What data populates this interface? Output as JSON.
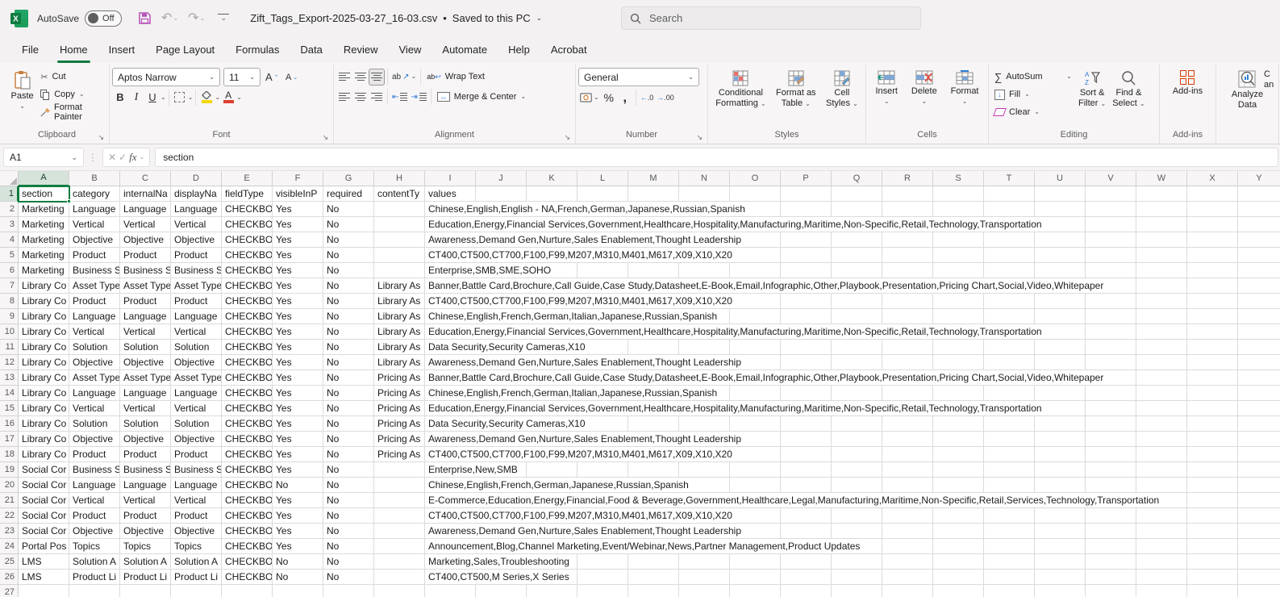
{
  "title_bar": {
    "autosave_label": "AutoSave",
    "autosave_state": "Off",
    "file_name": "Zift_Tags_Export-2025-03-27_16-03.csv",
    "separator": "•",
    "save_status": "Saved to this PC",
    "search_placeholder": "Search"
  },
  "tabs": [
    "File",
    "Home",
    "Insert",
    "Page Layout",
    "Formulas",
    "Data",
    "Review",
    "View",
    "Automate",
    "Help",
    "Acrobat"
  ],
  "active_tab_index": 1,
  "ribbon": {
    "clipboard": {
      "group_label": "Clipboard",
      "paste_label": "Paste",
      "cut_label": "Cut",
      "copy_label": "Copy",
      "format_painter_label": "Format Painter"
    },
    "font": {
      "group_label": "Font",
      "font_name": "Aptos Narrow",
      "font_size": "11",
      "bold": "B",
      "italic": "I",
      "underline": "U"
    },
    "alignment": {
      "group_label": "Alignment",
      "wrap_text_label": "Wrap Text",
      "merge_center_label": "Merge & Center",
      "orientation_label": "ab"
    },
    "number": {
      "group_label": "Number",
      "format_value": "General",
      "percent": "%",
      "comma": ",",
      "inc_decimal": "←.0",
      "dec_decimal": "→.00"
    },
    "styles": {
      "group_label": "Styles",
      "conditional_line1": "Conditional",
      "conditional_line2": "Formatting",
      "format_table_line1": "Format as",
      "format_table_line2": "Table",
      "cell_styles_line1": "Cell",
      "cell_styles_line2": "Styles"
    },
    "cells": {
      "group_label": "Cells",
      "insert_label": "Insert",
      "delete_label": "Delete",
      "format_label": "Format"
    },
    "editing": {
      "group_label": "Editing",
      "autosum_label": "AutoSum",
      "fill_label": "Fill",
      "clear_label": "Clear",
      "sort_filter_line1": "Sort &",
      "sort_filter_line2": "Filter",
      "find_select_line1": "Find &",
      "find_select_line2": "Select"
    },
    "addins": {
      "group_label": "Add-ins",
      "addins_label": "Add-ins"
    },
    "analyze": {
      "line1": "Analyze",
      "line2": "Data"
    },
    "clipped_group": {
      "line1": "C",
      "line2": "an"
    }
  },
  "formula_bar": {
    "name_box": "A1",
    "formula": "section",
    "fx": "fx"
  },
  "sheet": {
    "selected_cell": "A1",
    "columns": [
      "A",
      "B",
      "C",
      "D",
      "E",
      "F",
      "G",
      "H",
      "I",
      "J",
      "K",
      "L",
      "M",
      "N",
      "O",
      "P",
      "Q",
      "R",
      "S",
      "T",
      "U",
      "V",
      "W",
      "X",
      "Y"
    ],
    "rows": [
      {
        "n": "1",
        "cells": [
          "section",
          "category",
          "internalNa",
          "displayNa",
          "fieldType",
          "visibleInP",
          "required",
          "contentTy"
        ],
        "values": "values"
      },
      {
        "n": "2",
        "cells": [
          "Marketing",
          "Language",
          "Language",
          "Language",
          "CHECKBOX",
          "Yes",
          "No",
          ""
        ],
        "values": "Chinese,English,English - NA,French,German,Japanese,Russian,Spanish"
      },
      {
        "n": "3",
        "cells": [
          "Marketing",
          "Vertical",
          "Vertical",
          "Vertical",
          "CHECKBOX",
          "Yes",
          "No",
          ""
        ],
        "values": "Education,Energy,Financial Services,Government,Healthcare,Hospitality,Manufacturing,Maritime,Non-Specific,Retail,Technology,Transportation"
      },
      {
        "n": "4",
        "cells": [
          "Marketing",
          "Objective",
          "Objective",
          "Objective",
          "CHECKBOX",
          "Yes",
          "No",
          ""
        ],
        "values": "Awareness,Demand Gen,Nurture,Sales Enablement,Thought Leadership"
      },
      {
        "n": "5",
        "cells": [
          "Marketing",
          "Product",
          "Product",
          "Product",
          "CHECKBOX",
          "Yes",
          "No",
          ""
        ],
        "values": "CT400,CT500,CT700,F100,F99,M207,M310,M401,M617,X09,X10,X20"
      },
      {
        "n": "6",
        "cells": [
          "Marketing",
          "Business S",
          "Business S",
          "Business S",
          "CHECKBOX",
          "Yes",
          "No",
          ""
        ],
        "values": "Enterprise,SMB,SME,SOHO"
      },
      {
        "n": "7",
        "cells": [
          "Library Co",
          "Asset Type",
          "Asset Type",
          "Asset Type",
          "CHECKBOX",
          "Yes",
          "No",
          "Library As"
        ],
        "values": "Banner,Battle Card,Brochure,Call Guide,Case Study,Datasheet,E-Book,Email,Infographic,Other,Playbook,Presentation,Pricing Chart,Social,Video,Whitepaper"
      },
      {
        "n": "8",
        "cells": [
          "Library Co",
          "Product",
          "Product",
          "Product",
          "CHECKBOX",
          "Yes",
          "No",
          "Library As"
        ],
        "values": "CT400,CT500,CT700,F100,F99,M207,M310,M401,M617,X09,X10,X20"
      },
      {
        "n": "9",
        "cells": [
          "Library Co",
          "Language",
          "Language",
          "Language",
          "CHECKBOX",
          "Yes",
          "No",
          "Library As"
        ],
        "values": "Chinese,English,French,German,Italian,Japanese,Russian,Spanish"
      },
      {
        "n": "10",
        "cells": [
          "Library Co",
          "Vertical",
          "Vertical",
          "Vertical",
          "CHECKBOX",
          "Yes",
          "No",
          "Library As"
        ],
        "values": "Education,Energy,Financial Services,Government,Healthcare,Hospitality,Manufacturing,Maritime,Non-Specific,Retail,Technology,Transportation"
      },
      {
        "n": "11",
        "cells": [
          "Library Co",
          "Solution",
          "Solution",
          "Solution",
          "CHECKBOX",
          "Yes",
          "No",
          "Library As"
        ],
        "values": "Data Security,Security Cameras,X10"
      },
      {
        "n": "12",
        "cells": [
          "Library Co",
          "Objective",
          "Objective",
          "Objective",
          "CHECKBOX",
          "Yes",
          "No",
          "Library As"
        ],
        "values": "Awareness,Demand Gen,Nurture,Sales Enablement,Thought Leadership"
      },
      {
        "n": "13",
        "cells": [
          "Library Co",
          "Asset Type",
          "Asset Type",
          "Asset Type",
          "CHECKBOX",
          "Yes",
          "No",
          "Pricing As"
        ],
        "values": "Banner,Battle Card,Brochure,Call Guide,Case Study,Datasheet,E-Book,Email,Infographic,Other,Playbook,Presentation,Pricing Chart,Social,Video,Whitepaper"
      },
      {
        "n": "14",
        "cells": [
          "Library Co",
          "Language",
          "Language",
          "Language",
          "CHECKBOX",
          "Yes",
          "No",
          "Pricing As"
        ],
        "values": "Chinese,English,French,German,Italian,Japanese,Russian,Spanish"
      },
      {
        "n": "15",
        "cells": [
          "Library Co",
          "Vertical",
          "Vertical",
          "Vertical",
          "CHECKBOX",
          "Yes",
          "No",
          "Pricing As"
        ],
        "values": "Education,Energy,Financial Services,Government,Healthcare,Hospitality,Manufacturing,Maritime,Non-Specific,Retail,Technology,Transportation"
      },
      {
        "n": "16",
        "cells": [
          "Library Co",
          "Solution",
          "Solution",
          "Solution",
          "CHECKBOX",
          "Yes",
          "No",
          "Pricing As"
        ],
        "values": "Data Security,Security Cameras,X10"
      },
      {
        "n": "17",
        "cells": [
          "Library Co",
          "Objective",
          "Objective",
          "Objective",
          "CHECKBOX",
          "Yes",
          "No",
          "Pricing As"
        ],
        "values": "Awareness,Demand Gen,Nurture,Sales Enablement,Thought Leadership"
      },
      {
        "n": "18",
        "cells": [
          "Library Co",
          "Product",
          "Product",
          "Product",
          "CHECKBOX",
          "Yes",
          "No",
          "Pricing As"
        ],
        "values": "CT400,CT500,CT700,F100,F99,M207,M310,M401,M617,X09,X10,X20"
      },
      {
        "n": "19",
        "cells": [
          "Social Cor",
          "Business S",
          "Business S",
          "Business S",
          "CHECKBOX",
          "Yes",
          "No",
          ""
        ],
        "values": "Enterprise,New,SMB"
      },
      {
        "n": "20",
        "cells": [
          "Social Cor",
          "Language",
          "Language",
          "Language",
          "CHECKBOX",
          "No",
          "No",
          ""
        ],
        "values": "Chinese,English,French,German,Japanese,Russian,Spanish"
      },
      {
        "n": "21",
        "cells": [
          "Social Cor",
          "Vertical",
          "Vertical",
          "Vertical",
          "CHECKBOX",
          "Yes",
          "No",
          ""
        ],
        "values": "E-Commerce,Education,Energy,Financial,Food & Beverage,Government,Healthcare,Legal,Manufacturing,Maritime,Non-Specific,Retail,Services,Technology,Transportation"
      },
      {
        "n": "22",
        "cells": [
          "Social Cor",
          "Product",
          "Product",
          "Product",
          "CHECKBOX",
          "Yes",
          "No",
          ""
        ],
        "values": "CT400,CT500,CT700,F100,F99,M207,M310,M401,M617,X09,X10,X20"
      },
      {
        "n": "23",
        "cells": [
          "Social Cor",
          "Objective",
          "Objective",
          "Objective",
          "CHECKBOX",
          "Yes",
          "No",
          ""
        ],
        "values": "Awareness,Demand Gen,Nurture,Sales Enablement,Thought Leadership"
      },
      {
        "n": "24",
        "cells": [
          "Portal Pos",
          "Topics",
          "Topics",
          "Topics",
          "CHECKBOX",
          "Yes",
          "No",
          ""
        ],
        "values": "Announcement,Blog,Channel Marketing,Event/Webinar,News,Partner Management,Product Updates"
      },
      {
        "n": "25",
        "cells": [
          "LMS",
          "Solution A",
          "Solution A",
          "Solution A",
          "CHECKBOX",
          "No",
          "No",
          ""
        ],
        "values": "Marketing,Sales,Troubleshooting"
      },
      {
        "n": "26",
        "cells": [
          "LMS",
          "Product Li",
          "Product Li",
          "Product Li",
          "CHECKBOX",
          "No",
          "No",
          ""
        ],
        "values": "CT400,CT500,M Series,X Series"
      },
      {
        "n": "27",
        "cells": [
          "",
          "",
          "",
          "",
          "",
          "",
          "",
          ""
        ],
        "values": ""
      }
    ]
  }
}
